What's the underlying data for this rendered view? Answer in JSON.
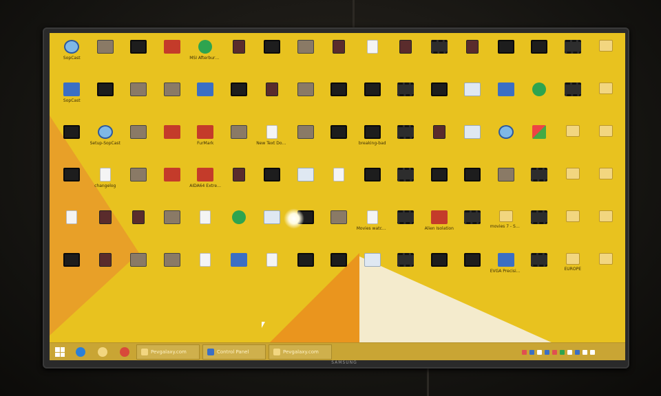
{
  "tv": {
    "brand": "SAMSUNG"
  },
  "desktop": {
    "icons": [
      {
        "label": "SopCast",
        "kind": "globe"
      },
      {
        "label": "",
        "kind": "photo"
      },
      {
        "label": "",
        "kind": "video"
      },
      {
        "label": "",
        "kind": "app2"
      },
      {
        "label": "MSI Afterburner",
        "kind": "green"
      },
      {
        "label": "",
        "kind": "poster"
      },
      {
        "label": "",
        "kind": "video"
      },
      {
        "label": "",
        "kind": "photo"
      },
      {
        "label": "",
        "kind": "poster"
      },
      {
        "label": "",
        "kind": "doc"
      },
      {
        "label": "",
        "kind": "poster"
      },
      {
        "label": "",
        "kind": "film"
      },
      {
        "label": "",
        "kind": "poster"
      },
      {
        "label": "",
        "kind": "video"
      },
      {
        "label": "",
        "kind": "video"
      },
      {
        "label": "",
        "kind": "film"
      },
      {
        "label": "",
        "kind": "folder"
      },
      {
        "label": "SopCast",
        "kind": "app"
      },
      {
        "label": "",
        "kind": "video"
      },
      {
        "label": "",
        "kind": "photo"
      },
      {
        "label": "",
        "kind": "photo"
      },
      {
        "label": "",
        "kind": "app"
      },
      {
        "label": "",
        "kind": "video"
      },
      {
        "label": "",
        "kind": "poster"
      },
      {
        "label": "",
        "kind": "photo"
      },
      {
        "label": "",
        "kind": "video"
      },
      {
        "label": "",
        "kind": "video"
      },
      {
        "label": "",
        "kind": "film"
      },
      {
        "label": "",
        "kind": "video"
      },
      {
        "label": "",
        "kind": "light"
      },
      {
        "label": "",
        "kind": "app"
      },
      {
        "label": "",
        "kind": "green"
      },
      {
        "label": "",
        "kind": "film"
      },
      {
        "label": "",
        "kind": "folder"
      },
      {
        "label": "",
        "kind": "video"
      },
      {
        "label": "Setup-SopCast",
        "kind": "globe"
      },
      {
        "label": "",
        "kind": "photo"
      },
      {
        "label": "",
        "kind": "app2"
      },
      {
        "label": "FurMark",
        "kind": "app2"
      },
      {
        "label": "",
        "kind": "photo"
      },
      {
        "label": "New Text Document",
        "kind": "doc"
      },
      {
        "label": "",
        "kind": "photo"
      },
      {
        "label": "",
        "kind": "video"
      },
      {
        "label": "breaking-bad",
        "kind": "video"
      },
      {
        "label": "",
        "kind": "film"
      },
      {
        "label": "",
        "kind": "poster"
      },
      {
        "label": "",
        "kind": "light"
      },
      {
        "label": "",
        "kind": "globe"
      },
      {
        "label": "",
        "kind": "win"
      },
      {
        "label": "",
        "kind": "folder"
      },
      {
        "label": "",
        "kind": "folder"
      },
      {
        "label": "",
        "kind": "video"
      },
      {
        "label": "changelog",
        "kind": "doc"
      },
      {
        "label": "",
        "kind": "photo"
      },
      {
        "label": "",
        "kind": "app2"
      },
      {
        "label": "AIDA64 Extreme",
        "kind": "app2"
      },
      {
        "label": "",
        "kind": "poster"
      },
      {
        "label": "",
        "kind": "video"
      },
      {
        "label": "",
        "kind": "light"
      },
      {
        "label": "",
        "kind": "doc"
      },
      {
        "label": "",
        "kind": "video"
      },
      {
        "label": "",
        "kind": "film"
      },
      {
        "label": "",
        "kind": "video"
      },
      {
        "label": "",
        "kind": "video"
      },
      {
        "label": "",
        "kind": "photo"
      },
      {
        "label": "",
        "kind": "film"
      },
      {
        "label": "",
        "kind": "folder"
      },
      {
        "label": "",
        "kind": "folder"
      },
      {
        "label": "",
        "kind": "doc"
      },
      {
        "label": "",
        "kind": "poster"
      },
      {
        "label": "",
        "kind": "poster"
      },
      {
        "label": "",
        "kind": "photo"
      },
      {
        "label": "",
        "kind": "doc"
      },
      {
        "label": "",
        "kind": "green"
      },
      {
        "label": "",
        "kind": "light"
      },
      {
        "label": "",
        "kind": "video"
      },
      {
        "label": "",
        "kind": "photo"
      },
      {
        "label": "Movies watched",
        "kind": "doc"
      },
      {
        "label": "",
        "kind": "film"
      },
      {
        "label": "Alien Isolation",
        "kind": "app2"
      },
      {
        "label": "",
        "kind": "film"
      },
      {
        "label": "movies 7 - Shortcut",
        "kind": "folder"
      },
      {
        "label": "",
        "kind": "film"
      },
      {
        "label": "",
        "kind": "folder"
      },
      {
        "label": "",
        "kind": "folder"
      },
      {
        "label": "",
        "kind": "video"
      },
      {
        "label": "",
        "kind": "poster"
      },
      {
        "label": "",
        "kind": "photo"
      },
      {
        "label": "",
        "kind": "photo"
      },
      {
        "label": "",
        "kind": "doc"
      },
      {
        "label": "",
        "kind": "app"
      },
      {
        "label": "",
        "kind": "doc"
      },
      {
        "label": "",
        "kind": "video"
      },
      {
        "label": "",
        "kind": "video"
      },
      {
        "label": "",
        "kind": "light"
      },
      {
        "label": "",
        "kind": "film"
      },
      {
        "label": "",
        "kind": "video"
      },
      {
        "label": "",
        "kind": "video"
      },
      {
        "label": "EVGA Precision X",
        "kind": "app"
      },
      {
        "label": "",
        "kind": "film"
      },
      {
        "label": "EUROPE",
        "kind": "folder"
      },
      {
        "label": "",
        "kind": "folder"
      }
    ]
  },
  "taskbar": {
    "pinned": [
      {
        "name": "ie-icon",
        "color": "#2a7fd8"
      },
      {
        "name": "explorer-icon",
        "color": "#f2d680"
      },
      {
        "name": "chrome-icon",
        "color": "#d84a3a"
      }
    ],
    "tasks": [
      {
        "label": "Pevgalaxy.com",
        "color": "#f2d680"
      },
      {
        "label": "Control Panel",
        "color": "#3b6fc4"
      },
      {
        "label": "Pevgalaxy.com",
        "color": "#f2d680"
      }
    ],
    "tray_colors": [
      "#e05050",
      "#3b6fc4",
      "#ffffff",
      "#3b6fc4",
      "#e05050",
      "#2ea44f",
      "#ffffff",
      "#3b6fc4",
      "#ffffff",
      "#ffffff"
    ]
  },
  "colors": {
    "desktop_bg": "#e8c21f",
    "taskbar_bg": "#c9a534"
  }
}
